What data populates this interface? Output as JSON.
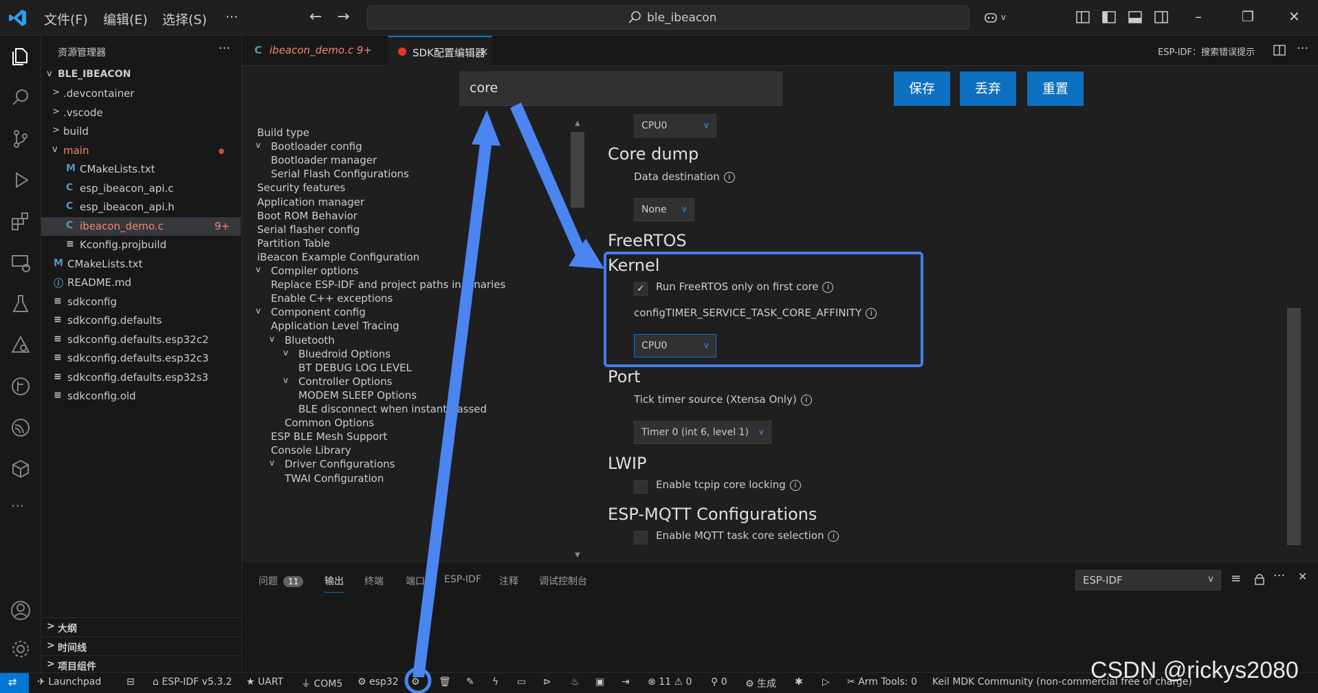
{
  "titlebar": {
    "menus": [
      "文件(F)",
      "编辑(E)",
      "选择(S)"
    ],
    "more": "···",
    "search": "ble_ibeacon"
  },
  "sidebar": {
    "title": "资源管理器",
    "more": "···",
    "root": "BLE_IBEACON",
    "items": [
      {
        "label": ".devcontainer",
        "chev": ">",
        "icon": ""
      },
      {
        "label": ".vscode",
        "chev": ">",
        "icon": ""
      },
      {
        "label": "build",
        "chev": ">",
        "icon": ""
      },
      {
        "label": "main",
        "chev": "v",
        "icon": ""
      },
      {
        "label": "CMakeLists.txt",
        "chev": "",
        "icon": "M"
      },
      {
        "label": "esp_ibeacon_api.c",
        "chev": "",
        "icon": "C"
      },
      {
        "label": "esp_ibeacon_api.h",
        "chev": "",
        "icon": "C"
      },
      {
        "label": "ibeacon_demo.c",
        "chev": "",
        "icon": "C",
        "badge": "9+"
      },
      {
        "label": "Kconfig.projbuild",
        "chev": "",
        "icon": "≡"
      },
      {
        "label": "CMakeLists.txt",
        "chev": "",
        "icon": "M"
      },
      {
        "label": "README.md",
        "chev": "",
        "icon": "ⓘ"
      },
      {
        "label": "sdkconfig",
        "chev": "",
        "icon": "≡"
      },
      {
        "label": "sdkconfig.defaults",
        "chev": "",
        "icon": "≡"
      },
      {
        "label": "sdkconfig.defaults.esp32c2",
        "chev": "",
        "icon": "≡"
      },
      {
        "label": "sdkconfig.defaults.esp32c3",
        "chev": "",
        "icon": "≡"
      },
      {
        "label": "sdkconfig.defaults.esp32s3",
        "chev": "",
        "icon": "≡"
      },
      {
        "label": "sdkconfig.old",
        "chev": "",
        "icon": "≡"
      }
    ],
    "sections": [
      "大纲",
      "时间线",
      "项目组件"
    ]
  },
  "tabs": [
    {
      "label": "ibeacon_demo.c  9+",
      "icon": "C"
    },
    {
      "label": "SDK配置编辑器",
      "close": "×"
    }
  ],
  "tabs_right": "ESP-IDF：搜索错误提示",
  "editor": {
    "search_value": "core",
    "buttons": {
      "save": "保存",
      "discard": "丢弃",
      "reset": "重置"
    },
    "menu": [
      {
        "label": "Build type",
        "indent": 0,
        "chev": ""
      },
      {
        "label": "Bootloader config",
        "indent": 1,
        "chev": "v"
      },
      {
        "label": "Bootloader manager",
        "indent": 1,
        "chev": ""
      },
      {
        "label": "Serial Flash Configurations",
        "indent": 1,
        "chev": ""
      },
      {
        "label": "Security features",
        "indent": 0,
        "chev": ""
      },
      {
        "label": "Application manager",
        "indent": 0,
        "chev": ""
      },
      {
        "label": "Boot ROM Behavior",
        "indent": 0,
        "chev": ""
      },
      {
        "label": "Serial flasher config",
        "indent": 0,
        "chev": ""
      },
      {
        "label": "Partition Table",
        "indent": 0,
        "chev": ""
      },
      {
        "label": "iBeacon Example Configuration",
        "indent": 0,
        "chev": ""
      },
      {
        "label": "Compiler options",
        "indent": 1,
        "chev": "v"
      },
      {
        "label": "Replace ESP-IDF and project paths in binaries",
        "indent": 1,
        "chev": ""
      },
      {
        "label": "Enable C++ exceptions",
        "indent": 1,
        "chev": ""
      },
      {
        "label": "Component config",
        "indent": 1,
        "chev": "v"
      },
      {
        "label": "Application Level Tracing",
        "indent": 1,
        "chev": ""
      },
      {
        "label": "Bluetooth",
        "indent": 2,
        "chev": "v"
      },
      {
        "label": "Bluedroid Options",
        "indent": 3,
        "chev": "v"
      },
      {
        "label": "BT DEBUG LOG LEVEL",
        "indent": 3,
        "chev": ""
      },
      {
        "label": "Controller Options",
        "indent": 3,
        "chev": "v"
      },
      {
        "label": "MODEM SLEEP Options",
        "indent": 3,
        "chev": ""
      },
      {
        "label": "BLE disconnect when instant passed",
        "indent": 3,
        "chev": ""
      },
      {
        "label": "Common Options",
        "indent": 2,
        "chev": ""
      },
      {
        "label": "ESP BLE Mesh Support",
        "indent": 1,
        "chev": ""
      },
      {
        "label": "Console Library",
        "indent": 1,
        "chev": ""
      },
      {
        "label": "Driver Configurations",
        "indent": 2,
        "chev": "v"
      },
      {
        "label": "TWAI Configuration",
        "indent": 2,
        "chev": ""
      }
    ],
    "content": {
      "top_dropdown": "CPU0",
      "coredump_title": "Core dump",
      "data_destination_label": "Data destination",
      "data_destination_value": "None",
      "freertos_title": "FreeRTOS",
      "kernel_title": "Kernel",
      "run_first_core_label": "Run FreeRTOS only on first core",
      "run_first_core_checked": true,
      "timer_affinity_label": "configTIMER_SERVICE_TASK_CORE_AFFINITY",
      "timer_affinity_value": "CPU0",
      "port_title": "Port",
      "tick_timer_label": "Tick timer source (Xtensa Only)",
      "tick_timer_value": "Timer 0 (int 6, level 1)",
      "lwip_title": "LWIP",
      "tcpip_label": "Enable tcpip core locking",
      "mqtt_title": "ESP-MQTT Configurations",
      "mqtt_label": "Enable MQTT task core selection"
    }
  },
  "panel": {
    "tabs": [
      {
        "label": "问题",
        "badge": "11"
      },
      {
        "label": "输出"
      },
      {
        "label": "终端"
      },
      {
        "label": "端口"
      },
      {
        "label": "ESP-IDF"
      },
      {
        "label": "注释"
      },
      {
        "label": "调试控制台"
      }
    ],
    "select_value": "ESP-IDF"
  },
  "statusbar": {
    "launchpad": "Launchpad",
    "idf_version": "ESP-IDF v5.3.2",
    "uart": "UART",
    "port": "COM5",
    "target": "esp32",
    "problems": "11",
    "warnings": "0",
    "ports": "0",
    "build": "生成",
    "arm_tools": "Arm Tools: 0",
    "keil": "Keil MDK Community (non-commercial free of charge)"
  },
  "watermark": "CSDN @rickys2080",
  "colors": {
    "accent": "#0078d4",
    "button": "#0e70c0",
    "highlight": "#3f7ff0"
  }
}
